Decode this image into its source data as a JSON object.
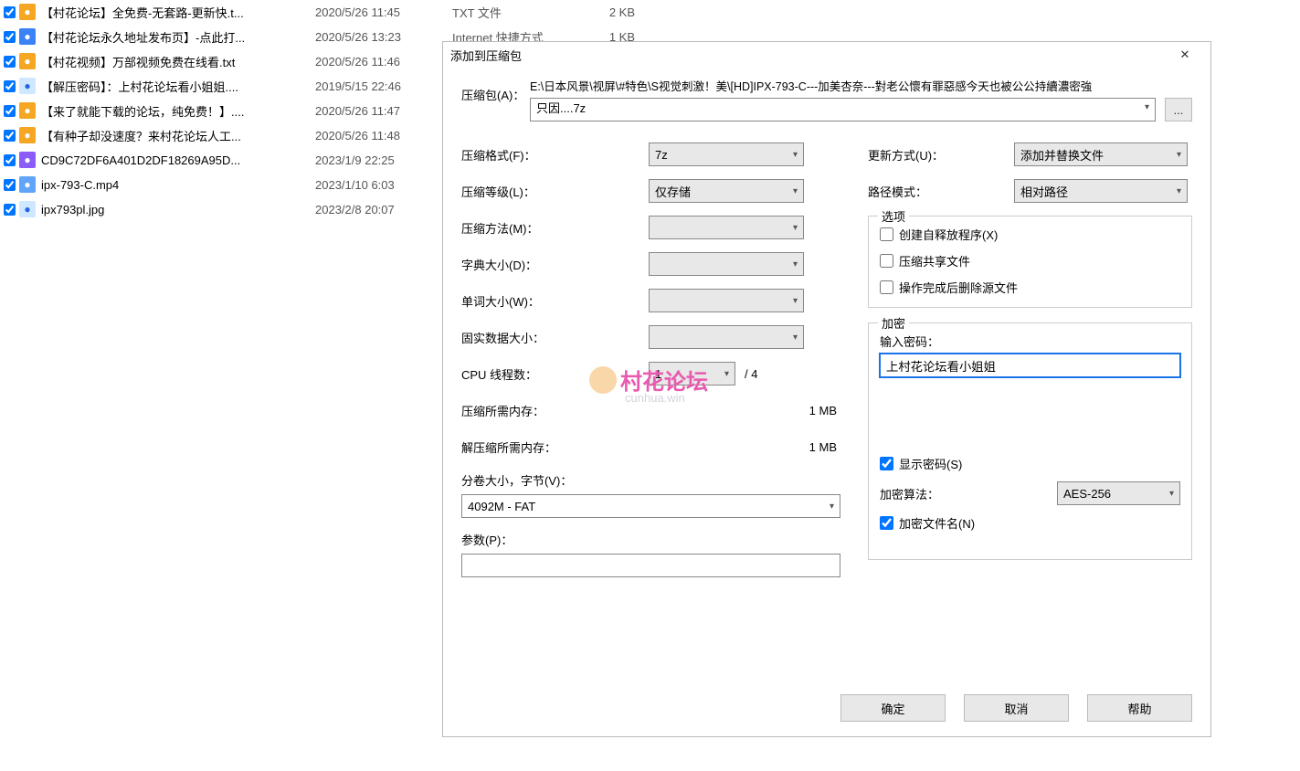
{
  "files": [
    {
      "name": "【村花论坛】全免费-无套路-更新快.t...",
      "date": "2020/5/26 11:45",
      "type": "TXT 文件",
      "size": "2 KB",
      "icon": "orange"
    },
    {
      "name": "【村花论坛永久地址发布页】-点此打...",
      "date": "2020/5/26 13:23",
      "type": "Internet 快捷方式",
      "size": "1 KB",
      "icon": "blue"
    },
    {
      "name": "【村花视频】万部视频免费在线看.txt",
      "date": "2020/5/26 11:46",
      "type": "",
      "size": "",
      "icon": "orange"
    },
    {
      "name": "【解压密码】：上村花论坛看小姐姐....",
      "date": "2019/5/15 22:46",
      "type": "",
      "size": "",
      "icon": "img"
    },
    {
      "name": "【来了就能下载的论坛，纯免费！】....",
      "date": "2020/5/26 11:47",
      "type": "",
      "size": "",
      "icon": "orange"
    },
    {
      "name": "【有种子却没速度？来村花论坛人工...",
      "date": "2020/5/26 11:48",
      "type": "",
      "size": "",
      "icon": "orange"
    },
    {
      "name": "CD9C72DF6A401D2DF18269A95D...",
      "date": "2023/1/9 22:25",
      "type": "",
      "size": "",
      "icon": "purple"
    },
    {
      "name": "ipx-793-C.mp4",
      "date": "2023/1/10 6:03",
      "type": "",
      "size": "",
      "icon": "vid"
    },
    {
      "name": "ipx793pl.jpg",
      "date": "2023/2/8 20:07",
      "type": "",
      "size": "",
      "icon": "img"
    }
  ],
  "dialog": {
    "title": "添加到压缩包",
    "archive": {
      "label": "压缩包(A)：",
      "path": "E:\\日本风景\\视屏\\#特色\\S视觉刺激！美\\[HD]IPX-793-C---加美杏奈---對老公懷有罪惡感今天也被公公持續濃密強",
      "name": "只因....7z",
      "browse": "..."
    },
    "left": {
      "format_label": "压缩格式(F)：",
      "format_value": "7z",
      "level_label": "压缩等级(L)：",
      "level_value": "仅存储",
      "method_label": "压缩方法(M)：",
      "method_value": "",
      "dict_label": "字典大小(D)：",
      "dict_value": "",
      "word_label": "单词大小(W)：",
      "word_value": "",
      "solid_label": "固实数据大小：",
      "solid_value": "",
      "cpu_label": "CPU 线程数：",
      "cpu_value": "1",
      "cpu_suffix": "/ 4",
      "mem_comp_label": "压缩所需内存：",
      "mem_comp_value": "1 MB",
      "mem_decomp_label": "解压缩所需内存：",
      "mem_decomp_value": "1 MB",
      "split_label": "分卷大小，字节(V)：",
      "split_value": "4092M - FAT",
      "params_label": "参数(P)：",
      "params_value": ""
    },
    "right": {
      "update_label": "更新方式(U)：",
      "update_value": "添加并替换文件",
      "pathmode_label": "路径模式：",
      "pathmode_value": "相对路径",
      "options_legend": "选项",
      "opt_sfx": "创建自释放程序(X)",
      "opt_share": "压缩共享文件",
      "opt_delete": "操作完成后删除源文件",
      "enc_legend": "加密",
      "pwd_label": "输入密码：",
      "pwd_value": "上村花论坛看小姐姐",
      "show_pwd": "显示密码(S)",
      "enc_alg_label": "加密算法：",
      "enc_alg_value": "AES-256",
      "enc_names": "加密文件名(N)"
    },
    "footer": {
      "ok": "确定",
      "cancel": "取消",
      "help": "帮助"
    }
  },
  "watermark": {
    "text": "村花论坛",
    "sub": "cunhua.win"
  }
}
